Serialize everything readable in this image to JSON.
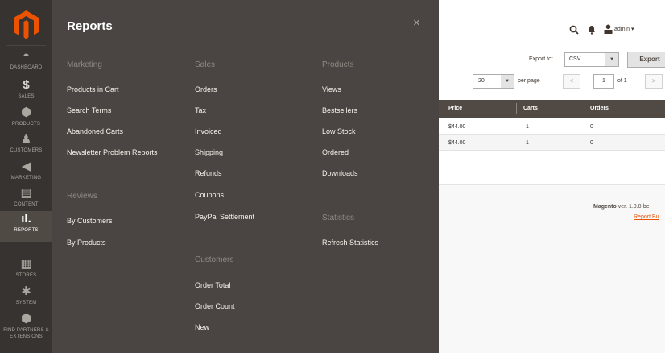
{
  "colors": {
    "brand": "#eb5202",
    "rail_bg": "#373330",
    "panel_bg": "#4a4542"
  },
  "nav": {
    "items": [
      {
        "name": "dashboard",
        "label": "DASHBOARD",
        "icon": "speedometer-icon"
      },
      {
        "name": "sales",
        "label": "SALES",
        "icon": "dollar-icon"
      },
      {
        "name": "products",
        "label": "PRODUCTS",
        "icon": "cube-icon"
      },
      {
        "name": "customers",
        "label": "CUSTOMERS",
        "icon": "person-icon"
      },
      {
        "name": "marketing",
        "label": "MARKETING",
        "icon": "megaphone-icon"
      },
      {
        "name": "content",
        "label": "CONTENT",
        "icon": "layout-icon"
      },
      {
        "name": "reports",
        "label": "REPORTS",
        "icon": "bar-chart-icon"
      },
      {
        "name": "stores",
        "label": "STORES",
        "icon": "storefront-icon"
      },
      {
        "name": "system",
        "label": "SYSTEM",
        "icon": "gear-icon"
      },
      {
        "name": "partners",
        "label": "FIND PARTNERS & EXTENSIONS",
        "icon": "box-icon"
      }
    ]
  },
  "panel": {
    "title": "Reports",
    "close": "×",
    "groups": {
      "marketing": {
        "title": "Marketing",
        "links": [
          "Products in Cart",
          "Search Terms",
          "Abandoned Carts",
          "Newsletter Problem Reports"
        ]
      },
      "reviews": {
        "title": "Reviews",
        "links": [
          "By Customers",
          "By Products"
        ]
      },
      "sales": {
        "title": "Sales",
        "links": [
          "Orders",
          "Tax",
          "Invoiced",
          "Shipping",
          "Refunds",
          "Coupons",
          "PayPal Settlement"
        ]
      },
      "customers": {
        "title": "Customers",
        "links": [
          "Order Total",
          "Order Count",
          "New"
        ]
      },
      "products": {
        "title": "Products",
        "links": [
          "Views",
          "Bestsellers",
          "Low Stock",
          "Ordered",
          "Downloads"
        ]
      },
      "statistics": {
        "title": "Statistics",
        "links": [
          "Refresh Statistics"
        ]
      }
    }
  },
  "header": {
    "user": "admin ▾"
  },
  "toolbar": {
    "export_to_label": "Export to:",
    "export_format": "CSV",
    "export_button": "Export",
    "per_page_value": "20",
    "per_page_label": "per page",
    "page_value": "1",
    "page_of": "of 1",
    "prev": "<",
    "next": ">"
  },
  "grid": {
    "columns": [
      "Price",
      "Carts",
      "Orders"
    ],
    "rows": [
      [
        "$44.00",
        "1",
        "0"
      ],
      [
        "$44.00",
        "1",
        "0"
      ]
    ]
  },
  "footer": {
    "brand": "Magento",
    "version": " ver. 1.0.0-be",
    "report_link": "Report Bu"
  }
}
